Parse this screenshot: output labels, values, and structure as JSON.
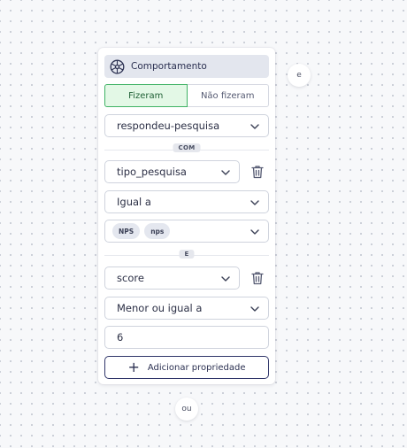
{
  "card": {
    "header_title": "Comportamento",
    "toggle": {
      "active_label": "Fizeram",
      "inactive_label": "Não fizeram"
    },
    "event_select": "respondeu-pesquisa",
    "with_label": "COM",
    "property1": {
      "name": "tipo_pesquisa",
      "operator": "Igual a",
      "values": [
        "NPS",
        "nps"
      ]
    },
    "and_label": "E",
    "property2": {
      "name": "score",
      "operator": "Menor ou igual a",
      "value": "6"
    },
    "add_property_label": "Adicionar propriedade"
  },
  "and_connector": "e",
  "or_connector": "ou",
  "icons": {
    "header": "behavior-icon",
    "delete": "trash-icon",
    "dropdown": "chevron-down-icon",
    "add": "plus-icon"
  },
  "colors": {
    "active_bg": "#e3f8e6",
    "active_border": "#3fb265",
    "primary": "#2b3051"
  }
}
